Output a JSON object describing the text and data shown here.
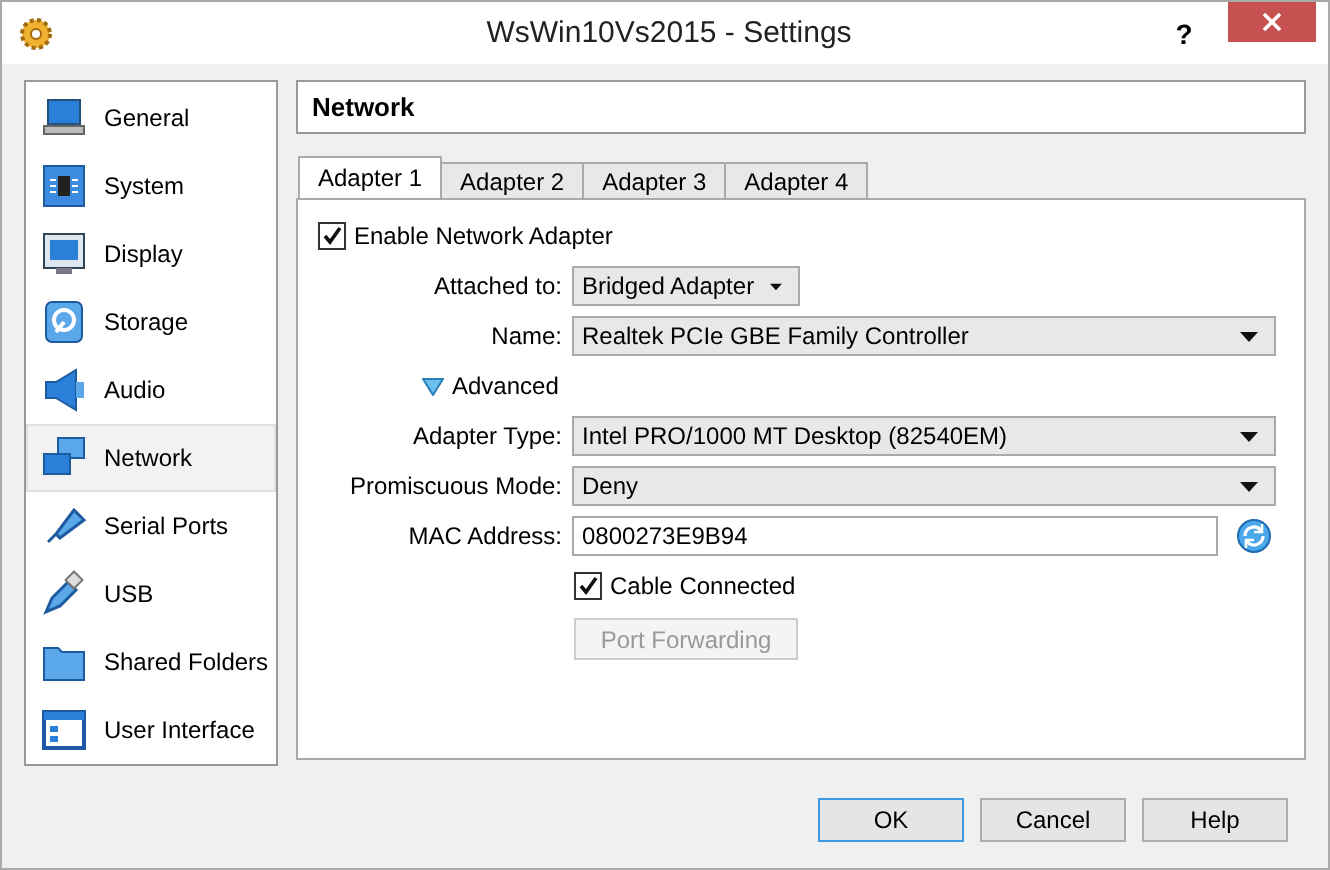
{
  "window": {
    "title": "WsWin10Vs2015 - Settings",
    "help_glyph": "?"
  },
  "sidebar": {
    "items": [
      {
        "label": "General",
        "kind": "general",
        "selected": false
      },
      {
        "label": "System",
        "kind": "system",
        "selected": false
      },
      {
        "label": "Display",
        "kind": "display",
        "selected": false
      },
      {
        "label": "Storage",
        "kind": "storage",
        "selected": false
      },
      {
        "label": "Audio",
        "kind": "audio",
        "selected": false
      },
      {
        "label": "Network",
        "kind": "network",
        "selected": true
      },
      {
        "label": "Serial Ports",
        "kind": "serial",
        "selected": false
      },
      {
        "label": "USB",
        "kind": "usb",
        "selected": false
      },
      {
        "label": "Shared Folders",
        "kind": "folder",
        "selected": false
      },
      {
        "label": "User Interface",
        "kind": "ui",
        "selected": false
      }
    ]
  },
  "page_title": "Network",
  "tabs": [
    {
      "label": "Adapter 1",
      "selected": true
    },
    {
      "label": "Adapter 2",
      "selected": false
    },
    {
      "label": "Adapter 3",
      "selected": false
    },
    {
      "label": "Adapter 4",
      "selected": false
    }
  ],
  "adapter": {
    "enable": {
      "label": "Enable Network Adapter",
      "checked": true
    },
    "attached_to": {
      "label": "Attached to:",
      "value": "Bridged Adapter"
    },
    "name": {
      "label": "Name:",
      "value": "Realtek PCIe GBE Family Controller"
    },
    "advanced": {
      "label": "Advanced",
      "expanded": true
    },
    "adapter_type": {
      "label": "Adapter Type:",
      "value": "Intel PRO/1000 MT Desktop (82540EM)"
    },
    "promiscuous_mode": {
      "label": "Promiscuous Mode:",
      "value": "Deny"
    },
    "mac_address": {
      "label": "MAC Address:",
      "value": "0800273E9B94"
    },
    "cable_connected": {
      "label": "Cable Connected",
      "checked": true
    },
    "port_forwarding": {
      "label": "Port Forwarding",
      "disabled": true
    }
  },
  "buttons": [
    {
      "label": "OK",
      "default": true
    },
    {
      "label": "Cancel",
      "default": false
    },
    {
      "label": "Help",
      "default": false
    }
  ]
}
